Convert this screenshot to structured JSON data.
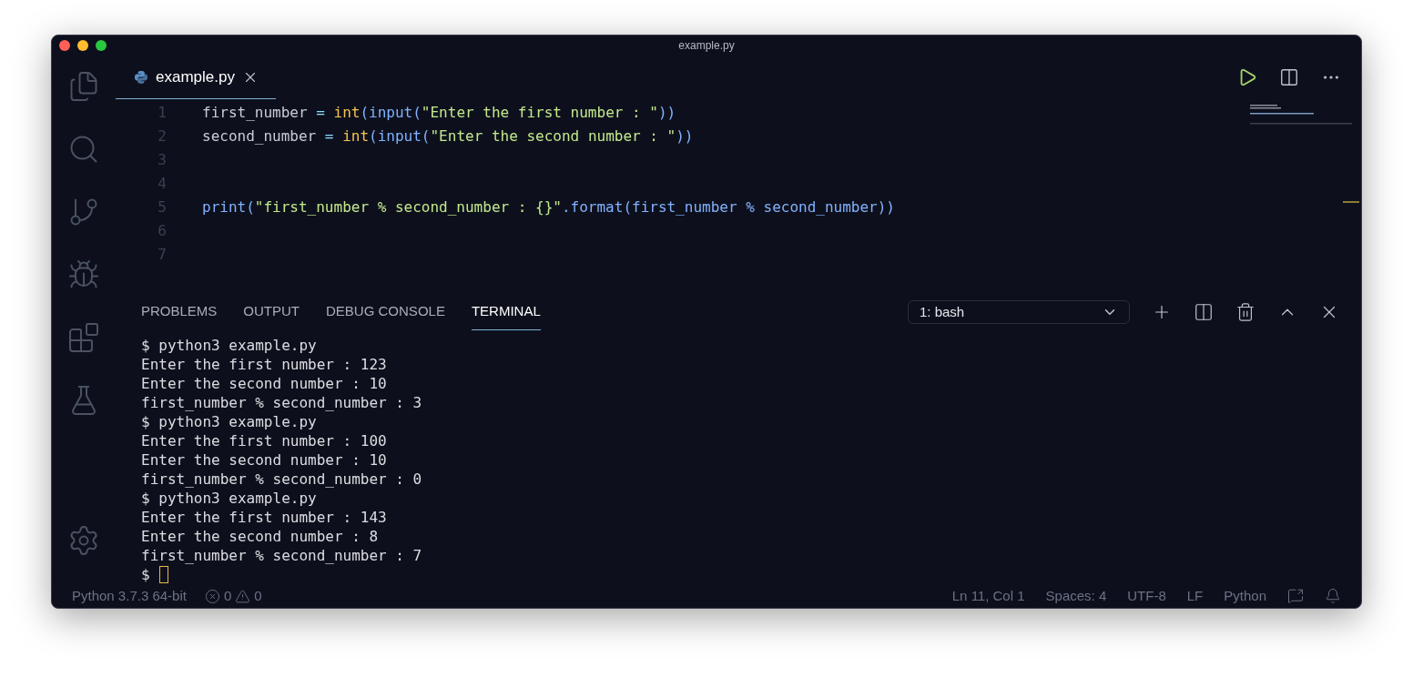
{
  "window": {
    "title": "example.py"
  },
  "editor_tabs": [
    {
      "label": "example.py",
      "selected": true
    }
  ],
  "code_lines": [
    {
      "number": "1",
      "tokens": [
        {
          "kind": "name",
          "text": "first_number"
        },
        {
          "kind": "op",
          "text": " = "
        },
        {
          "kind": "builtin",
          "text": "int"
        },
        {
          "kind": "func",
          "text": "(input("
        },
        {
          "kind": "string",
          "text": "\"Enter the first number : \""
        },
        {
          "kind": "func",
          "text": "))"
        }
      ]
    },
    {
      "number": "2",
      "tokens": [
        {
          "kind": "name",
          "text": "second_number"
        },
        {
          "kind": "op",
          "text": " = "
        },
        {
          "kind": "builtin",
          "text": "int"
        },
        {
          "kind": "func",
          "text": "(input("
        },
        {
          "kind": "string",
          "text": "\"Enter the second number : \""
        },
        {
          "kind": "func",
          "text": "))"
        }
      ]
    },
    {
      "number": "3"
    },
    {
      "number": "4"
    },
    {
      "number": "5",
      "tokens": [
        {
          "kind": "func",
          "text": "print("
        },
        {
          "kind": "string",
          "text": "\"first_number % second_number : {}\""
        },
        {
          "kind": "func",
          "text": ".format(first_number % second_number))"
        }
      ]
    },
    {
      "number": "6"
    },
    {
      "number": "7"
    }
  ],
  "panel_tabs": [
    {
      "label": "PROBLEMS",
      "selected": false
    },
    {
      "label": "OUTPUT",
      "selected": false
    },
    {
      "label": "DEBUG CONSOLE",
      "selected": false
    },
    {
      "label": "TERMINAL",
      "selected": true
    }
  ],
  "terminal_selector": {
    "value": "1: bash"
  },
  "terminal_lines": [
    {
      "text": "$ python3 example.py"
    },
    {
      "text": "Enter the first number : 123"
    },
    {
      "text": "Enter the second number : 10"
    },
    {
      "text": "first_number % second_number : 3"
    },
    {
      "text": "$ python3 example.py"
    },
    {
      "text": "Enter the first number : 100"
    },
    {
      "text": "Enter the second number : 10"
    },
    {
      "text": "first_number % second_number : 0"
    },
    {
      "text": "$ python3 example.py"
    },
    {
      "text": "Enter the first number : 143"
    },
    {
      "text": "Enter the second number : 8"
    },
    {
      "text": "first_number % second_number : 7"
    },
    {
      "text": "$",
      "cursor": true
    }
  ],
  "status_bar": {
    "interpreter": "Python 3.7.3 64-bit",
    "errors": "0",
    "warnings": "0",
    "right_items": [
      "Ln 11, Col 1",
      "Spaces: 4",
      "UTF-8",
      "LF",
      "Python"
    ]
  }
}
